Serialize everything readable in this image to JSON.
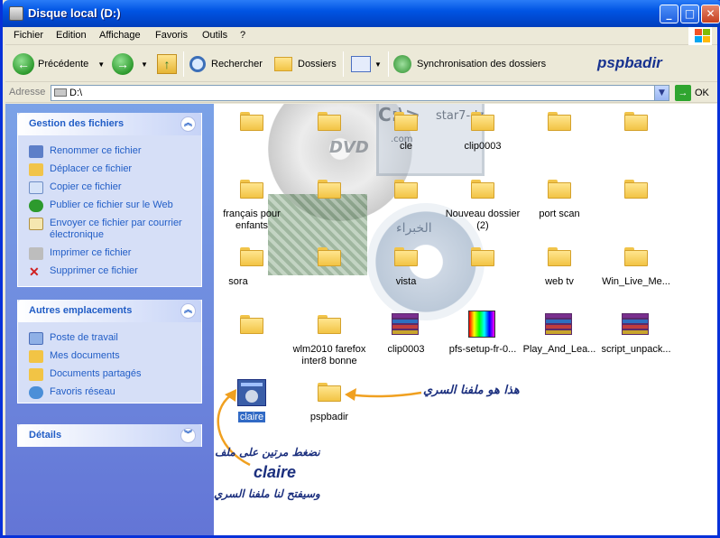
{
  "window": {
    "title": "Disque local (D:)"
  },
  "menubar": {
    "items": [
      "Fichier",
      "Edition",
      "Affichage",
      "Favoris",
      "Outils",
      "?"
    ]
  },
  "toolbar": {
    "back_label": "Précédente",
    "search_label": "Rechercher",
    "folders_label": "Dossiers",
    "sync_label": "Synchronisation des dossiers",
    "brand_text": "pspbadir"
  },
  "address": {
    "label": "Adresse",
    "value": "D:\\",
    "go_label": "OK"
  },
  "file_tasks": {
    "title": "Gestion des fichiers",
    "items": [
      "Renommer ce fichier",
      "Déplacer ce fichier",
      "Copier ce fichier",
      "Publier ce fichier sur le Web",
      "Envoyer ce fichier par courrier électronique",
      "Imprimer ce fichier",
      "Supprimer ce fichier"
    ]
  },
  "other_places": {
    "title": "Autres emplacements",
    "items": [
      "Poste de travail",
      "Mes documents",
      "Documents partagés",
      "Favoris réseau"
    ]
  },
  "details": {
    "title": "Détails"
  },
  "files": [
    {
      "name": "",
      "type": "folder"
    },
    {
      "name": "",
      "type": "folder"
    },
    {
      "name": "cle",
      "type": "folder"
    },
    {
      "name": "clip0003",
      "type": "folder"
    },
    {
      "name": "",
      "type": "folder"
    },
    {
      "name": "",
      "type": "folder"
    },
    {
      "name": "français pour enfants",
      "type": "folder"
    },
    {
      "name": "",
      "type": "folder"
    },
    {
      "name": "",
      "type": "folder"
    },
    {
      "name": "Nouveau dossier (2)",
      "type": "folder"
    },
    {
      "name": "port scan",
      "type": "folder"
    },
    {
      "name": "",
      "type": "folder"
    },
    {
      "name": "sora",
      "type": "folder"
    },
    {
      "name": "",
      "type": "folder"
    },
    {
      "name": "vista",
      "type": "folder"
    },
    {
      "name": "",
      "type": "folder"
    },
    {
      "name": "web tv",
      "type": "folder"
    },
    {
      "name": "Win_Live_Me...",
      "type": "folder"
    },
    {
      "name": "",
      "type": "folder"
    },
    {
      "name": "wlm2010 farefox inter8 bonne",
      "type": "folder"
    },
    {
      "name": "clip0003",
      "type": "rar"
    },
    {
      "name": "pfs-setup-fr-0...",
      "type": "exe"
    },
    {
      "name": "Play_And_Lea...",
      "type": "rar"
    },
    {
      "name": "script_unpack...",
      "type": "rar"
    },
    {
      "name": "claire",
      "type": "app"
    },
    {
      "name": "pspbadir",
      "type": "folder"
    }
  ],
  "annotations": {
    "secret_folder": "هذا هو ملفنا السري",
    "double_click": "نضغط مرتين على ملف",
    "file_name": "claire",
    "will_open": "وسيفتح لنا ملفنا السري"
  },
  "watermark": {
    "text1": "star7-dz",
    "text2": ".com",
    "text3": "DVD",
    "text4": "C:\\>",
    "text5": "الخبراء"
  },
  "colors": {
    "title_bar": "#0054e3",
    "task_pane": "#6375d6",
    "annotation": "#1b2f7e",
    "arrow": "#f0a020"
  }
}
